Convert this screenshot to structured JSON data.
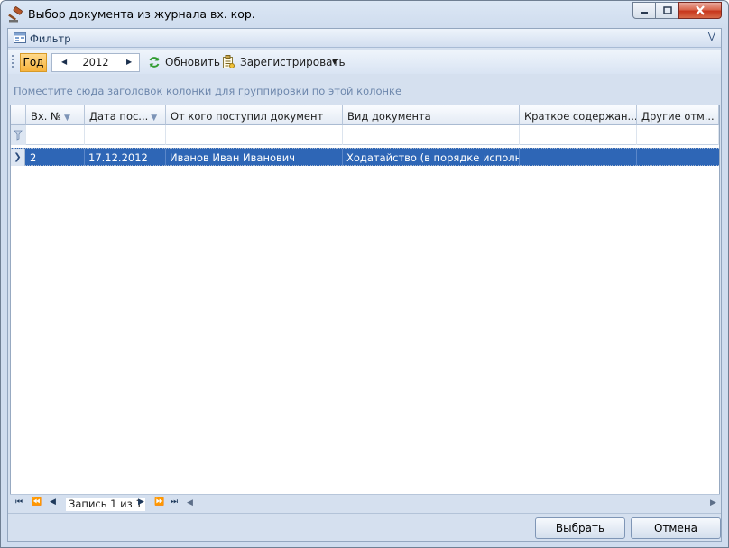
{
  "window": {
    "title": "Выбор документа из журнала вх. кор."
  },
  "filter": {
    "label": "Фильтр"
  },
  "toolbar": {
    "year_button": "Год",
    "year_value": "2012",
    "refresh_label": "Обновить",
    "register_label": "Зарегистрировать"
  },
  "group_panel": {
    "hint": "Поместите сюда заголовок колонки для группировки по этой колонке"
  },
  "grid": {
    "columns": [
      "Вх. №",
      "Дата пос...",
      "От кого поступил документ",
      "Вид документа",
      "Краткое содержан...",
      "Другие отм..."
    ],
    "rows": [
      {
        "num": "2",
        "date": "17.12.2012",
        "from": "Иванов Иван Иванович",
        "type": "Ходатайство (в порядке исполнен...",
        "summary": "",
        "other": ""
      }
    ]
  },
  "pager": {
    "text": "Запись 1 из 1"
  },
  "buttons": {
    "ok": "Выбрать",
    "cancel": "Отмена"
  },
  "colors": {
    "selection": "#2e66b6",
    "accent_year": "#f7b33d",
    "close_button": "#c7361c"
  }
}
